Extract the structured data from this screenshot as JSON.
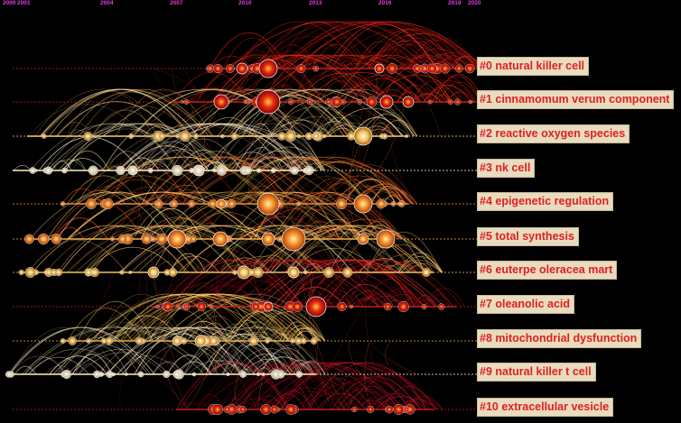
{
  "years": [
    "2000",
    "2001",
    "2004",
    "2007",
    "2010",
    "2013",
    "2016",
    "2019",
    "2020"
  ],
  "clusters": [
    {
      "label": "#0 natural killer cell"
    },
    {
      "label": "#1 cinnamomum verum component"
    },
    {
      "label": "#2 reactive oxygen species"
    },
    {
      "label": "#3 nk cell"
    },
    {
      "label": "#4 epigenetic regulation"
    },
    {
      "label": "#5 total synthesis"
    },
    {
      "label": "#6 euterpe oleracea mart"
    },
    {
      "label": "#7 oleanolic acid"
    },
    {
      "label": "#8 mitochondrial dysfunction"
    },
    {
      "label": "#9 natural killer t cell"
    },
    {
      "label": "#10 extracellular vesicle"
    }
  ]
}
